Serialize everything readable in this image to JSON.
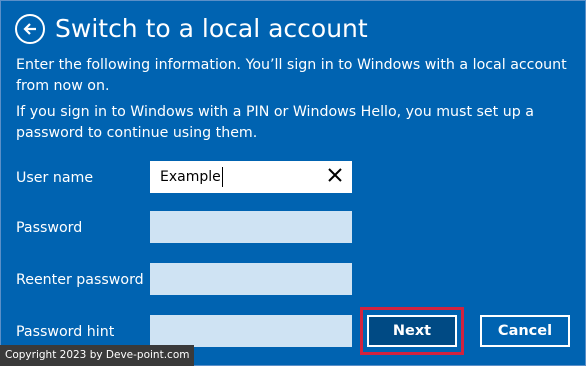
{
  "header": {
    "back_icon": "arrow-left-circle-icon",
    "title": "Switch to a local account"
  },
  "intro": {
    "paragraph1": "Enter the following information. You’ll sign in to Windows with a local account from now on.",
    "paragraph2": "If you sign in to Windows with a PIN or Windows Hello, you must set up a password to continue using them."
  },
  "form": {
    "user_name": {
      "label": "User name",
      "value": "Example",
      "clear_icon": "close-x-icon"
    },
    "password": {
      "label": "Password",
      "value": ""
    },
    "reenter_password": {
      "label": "Reenter password",
      "value": ""
    },
    "password_hint": {
      "label": "Password hint",
      "value": ""
    }
  },
  "actions": {
    "next_label": "Next",
    "cancel_label": "Cancel",
    "highlight_color": "#d2233f"
  },
  "watermark": {
    "text": "Copyright 2023 by Deve-point.com"
  },
  "colors": {
    "background": "#0063b1",
    "input_empty": "#cfe3f3",
    "next_button": "#004a84"
  }
}
